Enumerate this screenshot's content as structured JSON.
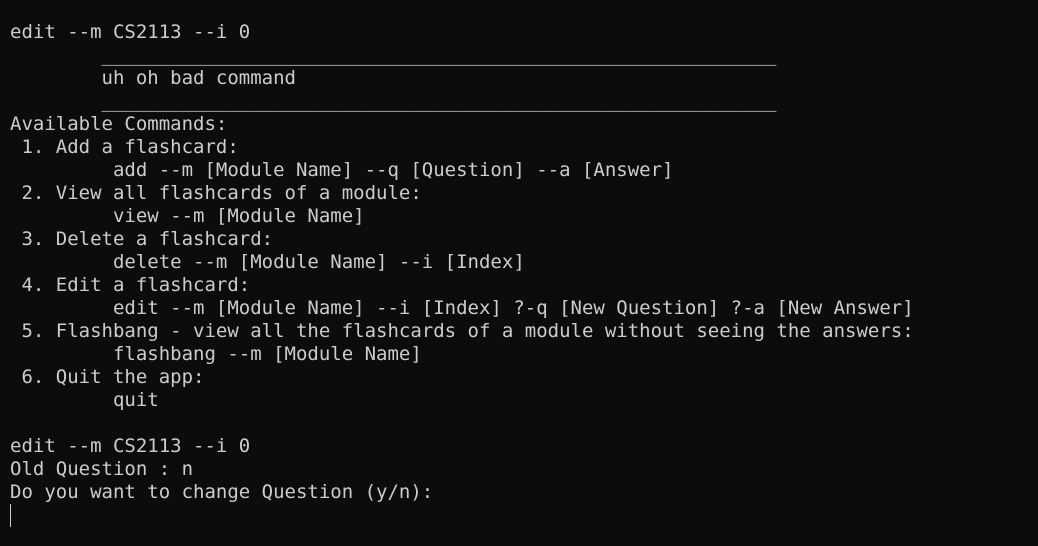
{
  "terminal": {
    "cmd1": "edit --m CS2113 --i 0",
    "sep1": "        ___________________________________________________________",
    "error": "        uh oh bad command",
    "sep2": "        ___________________________________________________________",
    "help_header": "Available Commands:",
    "cmd_items": [
      {
        "title": " 1. Add a flashcard:",
        "usage": "         add --m [Module Name] --q [Question] --a [Answer]"
      },
      {
        "title": " 2. View all flashcards of a module:",
        "usage": "         view --m [Module Name]"
      },
      {
        "title": " 3. Delete a flashcard:",
        "usage": "         delete --m [Module Name] --i [Index]"
      },
      {
        "title": " 4. Edit a flashcard:",
        "usage": "         edit --m [Module Name] --i [Index] ?-q [New Question] ?-a [New Answer]"
      },
      {
        "title": " 5. Flashbang - view all the flashcards of a module without seeing the answers:",
        "usage": "         flashbang --m [Module Name]"
      },
      {
        "title": " 6. Quit the app:",
        "usage": "         quit"
      }
    ],
    "cmd2": "edit --m CS2113 --i 0",
    "old_question": "Old Question : n",
    "prompt": "Do you want to change Question (y/n):"
  }
}
